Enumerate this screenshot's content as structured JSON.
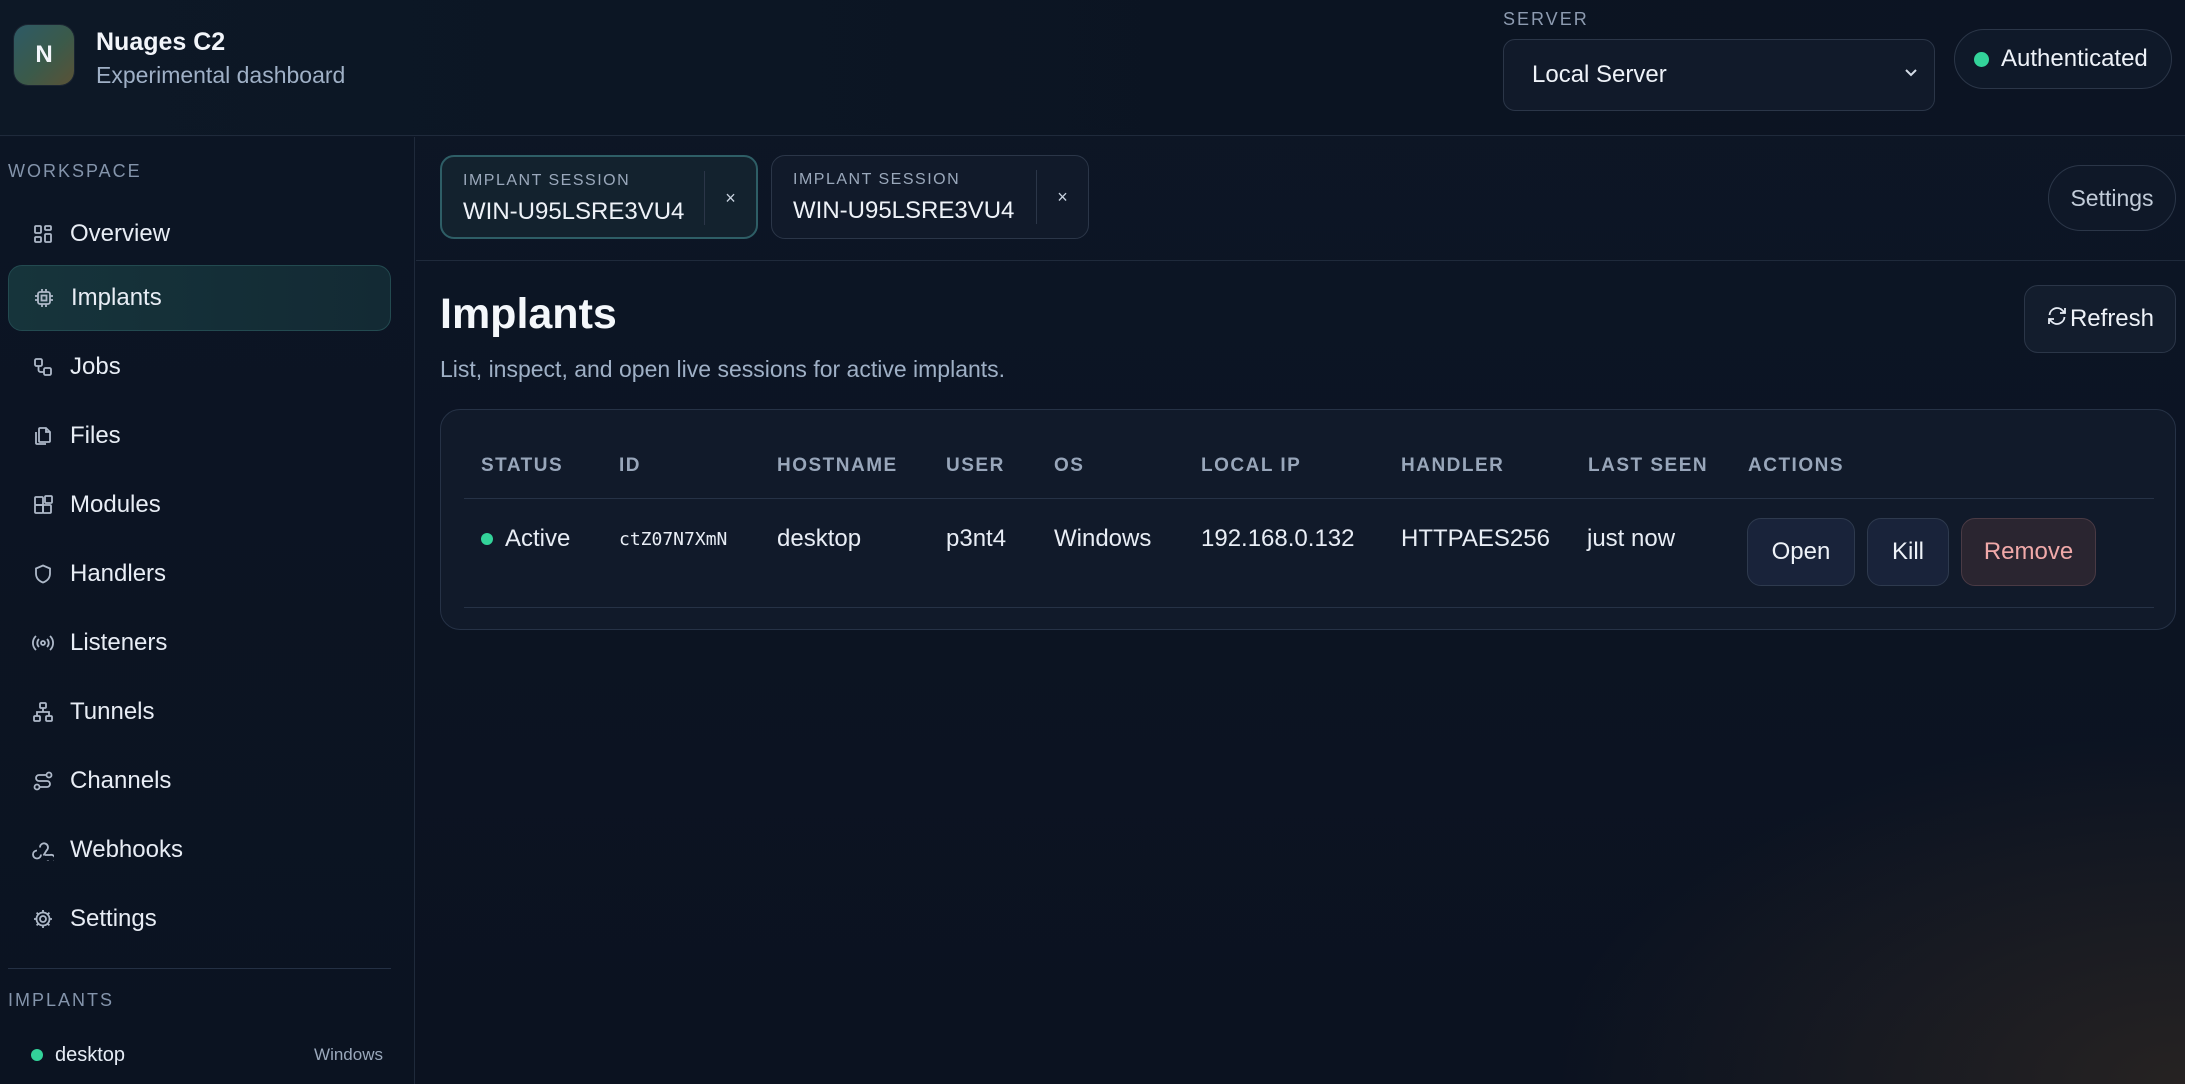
{
  "app": {
    "logo_letter": "N",
    "title": "Nuages C2",
    "subtitle": "Experimental dashboard"
  },
  "server": {
    "label": "SERVER",
    "selected": "Local Server",
    "status": "Authenticated",
    "status_color": "#33d39a"
  },
  "sidebar": {
    "workspace_label": "WORKSPACE",
    "items": [
      {
        "label": "Overview",
        "icon": "grid-icon"
      },
      {
        "label": "Implants",
        "icon": "cpu-icon",
        "active": true
      },
      {
        "label": "Jobs",
        "icon": "workflow-icon"
      },
      {
        "label": "Files",
        "icon": "files-icon"
      },
      {
        "label": "Modules",
        "icon": "blocks-icon"
      },
      {
        "label": "Handlers",
        "icon": "shield-icon"
      },
      {
        "label": "Listeners",
        "icon": "radio-icon"
      },
      {
        "label": "Tunnels",
        "icon": "network-icon"
      },
      {
        "label": "Channels",
        "icon": "route-icon"
      },
      {
        "label": "Webhooks",
        "icon": "webhook-icon"
      },
      {
        "label": "Settings",
        "icon": "gear-icon"
      }
    ],
    "implants_label": "IMPLANTS",
    "implants": [
      {
        "name": "desktop",
        "os": "Windows"
      }
    ]
  },
  "tabs": [
    {
      "label": "IMPLANT SESSION",
      "name": "WIN-U95LSRE3VU4",
      "close": "×"
    },
    {
      "label": "IMPLANT SESSION",
      "name": "WIN-U95LSRE3VU4",
      "close": "×"
    }
  ],
  "settings_button": "Settings",
  "main": {
    "title": "Implants",
    "subtitle": "List, inspect, and open live sessions for active implants.",
    "refresh_label": "Refresh",
    "columns": [
      "STATUS",
      "ID",
      "HOSTNAME",
      "USER",
      "OS",
      "LOCAL IP",
      "HANDLER",
      "LAST SEEN",
      "ACTIONS"
    ],
    "rows": [
      {
        "status": "Active",
        "id": "ctZ07N7XmN",
        "hostname": "desktop",
        "user": "p3nt4",
        "os": "Windows",
        "local_ip": "192.168.0.132",
        "handler": "HTTPAES256",
        "last_seen": "just now",
        "actions": [
          "Open",
          "Kill",
          "Remove"
        ]
      }
    ]
  }
}
